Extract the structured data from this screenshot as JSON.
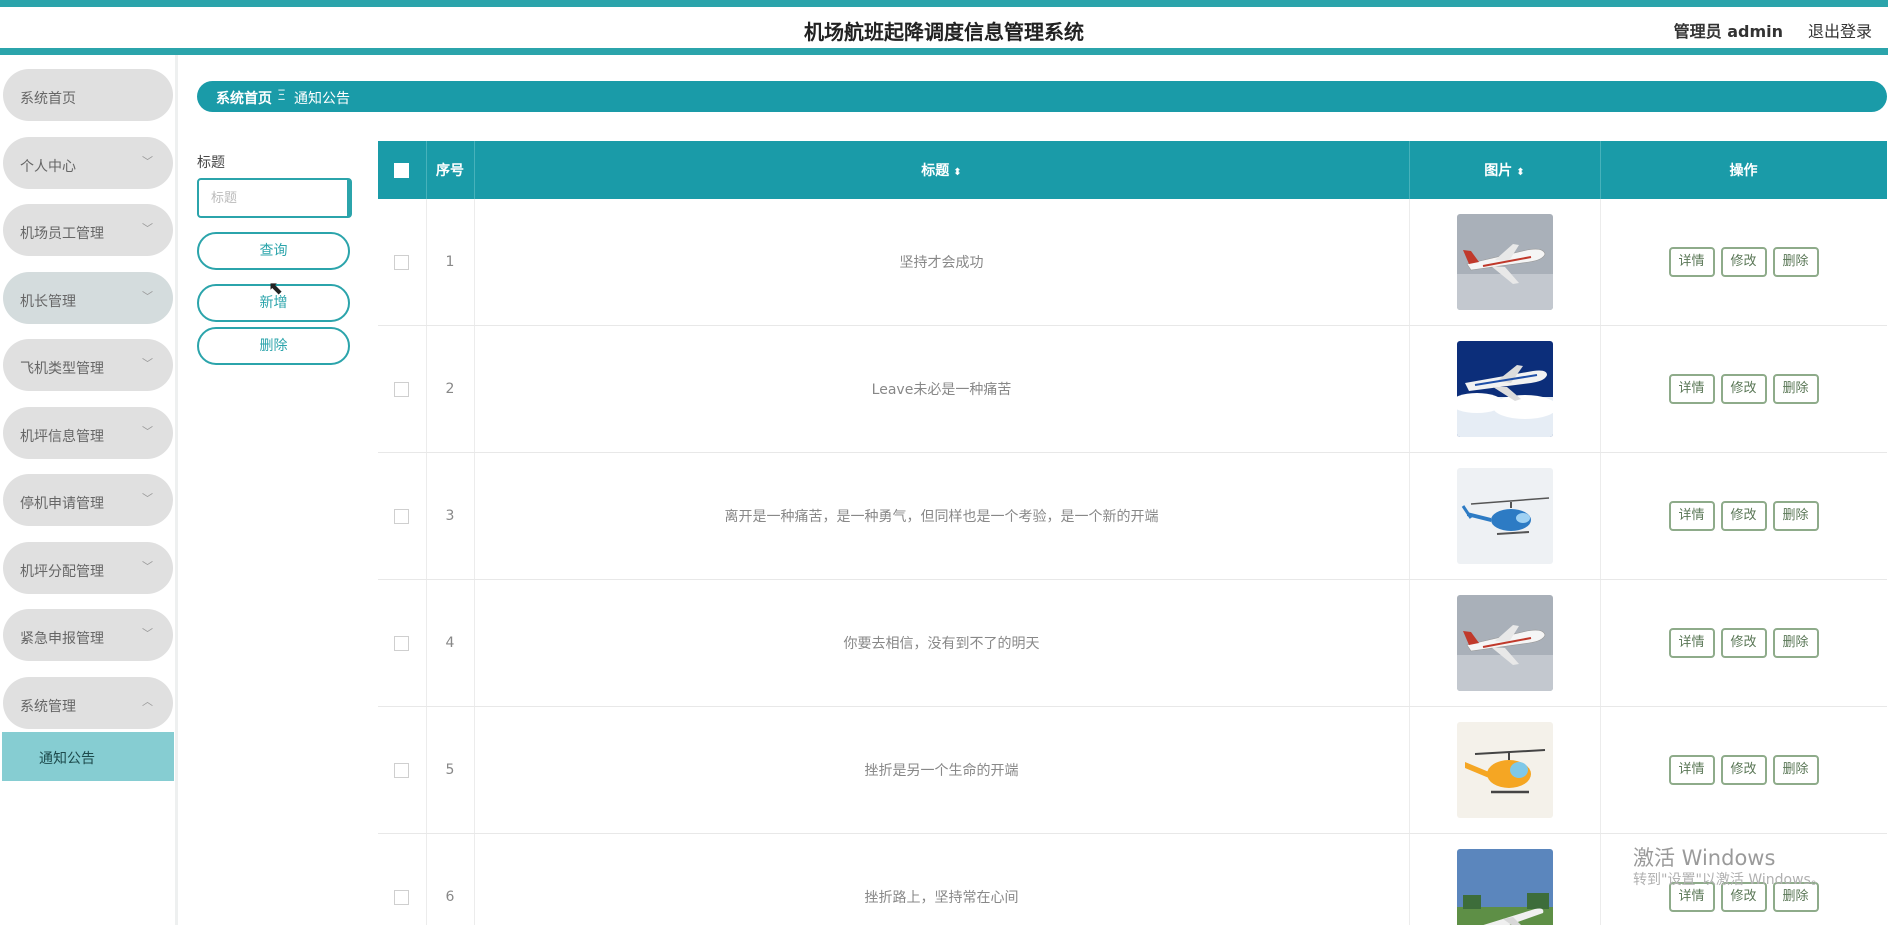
{
  "header": {
    "title": "机场航班起降调度信息管理系统",
    "user": "管理员 admin",
    "logout": "退出登录",
    "accent": "#2ba4ab"
  },
  "sidebar": {
    "items": [
      {
        "label": "系统首页",
        "chevron": ""
      },
      {
        "label": "个人中心",
        "chevron": "﹀"
      },
      {
        "label": "机场员工管理",
        "chevron": "﹀"
      },
      {
        "label": "机长管理",
        "chevron": "﹀"
      },
      {
        "label": "飞机类型管理",
        "chevron": "﹀"
      },
      {
        "label": "机坪信息管理",
        "chevron": "﹀"
      },
      {
        "label": "停机申请管理",
        "chevron": "﹀"
      },
      {
        "label": "机坪分配管理",
        "chevron": "﹀"
      },
      {
        "label": "紧急申报管理",
        "chevron": "﹀"
      },
      {
        "label": "系统管理",
        "chevron": "︿"
      }
    ],
    "subitem": "通知公告"
  },
  "breadcrumb": {
    "home": "系统首页",
    "separator": "Ξ",
    "current": "通知公告"
  },
  "search": {
    "label": "标题",
    "placeholder": "标题",
    "query_button": "查询",
    "add_button": "新增",
    "delete_button": "删除"
  },
  "table": {
    "columns": {
      "index": "序号",
      "title": "标题",
      "image": "图片",
      "ops": "操作",
      "sort_icon": "⬍"
    },
    "ops": {
      "detail": "详情",
      "edit": "修改",
      "delete": "删除"
    },
    "rows": [
      {
        "index": "1",
        "title": "坚持才会成功",
        "image_icon": "white-airliner"
      },
      {
        "index": "2",
        "title": "Leave未必是一种痛苦",
        "image_icon": "jumbo-jet-clouds"
      },
      {
        "index": "3",
        "title": "离开是一种痛苦，是一种勇气，但同样也是一个考验，是一个新的开端",
        "image_icon": "blue-helicopter"
      },
      {
        "index": "4",
        "title": "你要去相信，没有到不了的明天",
        "image_icon": "white-airliner"
      },
      {
        "index": "5",
        "title": "挫折是另一个生命的开端",
        "image_icon": "orange-helicopter"
      },
      {
        "index": "6",
        "title": "挫折路上，坚持常在心间",
        "image_icon": "parked-plane-field"
      }
    ]
  },
  "watermark": {
    "line1": "激活 Windows",
    "line2": "转到\"设置\"以激活 Windows。"
  }
}
